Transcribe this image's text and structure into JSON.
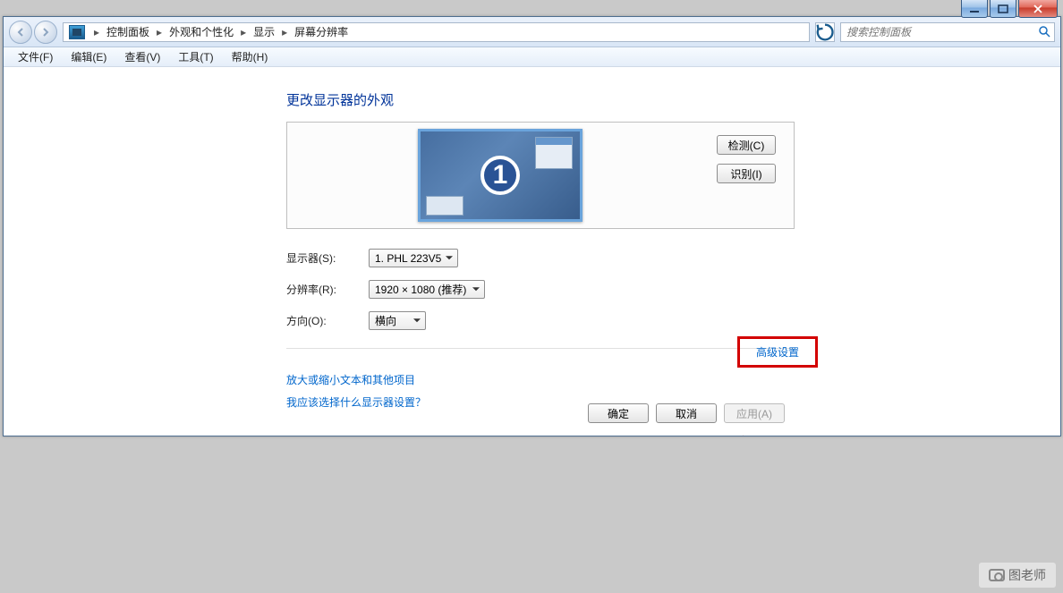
{
  "window_controls": {
    "minimize": "minimize",
    "maximize": "maximize",
    "close": "close"
  },
  "breadcrumb": {
    "items": [
      "控制面板",
      "外观和个性化",
      "显示",
      "屏幕分辨率"
    ]
  },
  "search": {
    "placeholder": "搜索控制面板"
  },
  "menu": {
    "file": "文件(F)",
    "edit": "编辑(E)",
    "view": "查看(V)",
    "tools": "工具(T)",
    "help": "帮助(H)"
  },
  "page": {
    "title": "更改显示器的外观",
    "monitor_number": "1",
    "detect_btn": "检测(C)",
    "identify_btn": "识别(I)"
  },
  "form": {
    "display_label": "显示器(S):",
    "display_value": "1. PHL 223V5",
    "resolution_label": "分辨率(R):",
    "resolution_value": "1920 × 1080 (推荐)",
    "orientation_label": "方向(O):",
    "orientation_value": "横向"
  },
  "links": {
    "advanced": "高级设置",
    "text_size": "放大或缩小文本和其他项目",
    "help": "我应该选择什么显示器设置？"
  },
  "buttons": {
    "ok": "确定",
    "cancel": "取消",
    "apply": "应用(A)"
  },
  "watermark": "图老师"
}
